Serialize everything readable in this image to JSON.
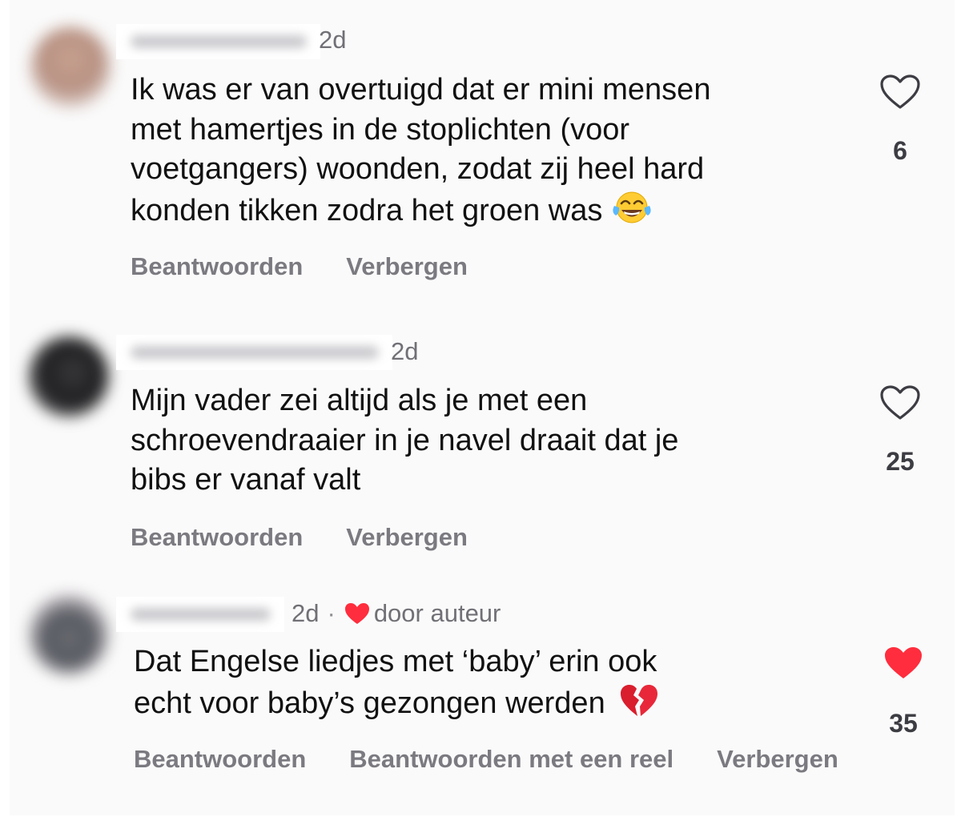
{
  "colors": {
    "like_active": "#ff2d3d",
    "muted_text": "#7a7a80",
    "panel_bg": "#fafafa"
  },
  "comments": [
    {
      "time": "2d",
      "lines": [
        "Ik was er van overtuigd dat er mini mensen",
        "met hamertjes in de stoplichten (voor",
        "voetgangers) woonden, zodat zij heel hard",
        "konden tikken zodra het groen was"
      ],
      "emoji": "tears-of-joy-emoji",
      "likes": "6",
      "liked": false,
      "actions": [
        "Beantwoorden",
        "Verbergen"
      ]
    },
    {
      "time": "2d",
      "lines": [
        "Mijn vader zei altijd als je met een",
        "schroevendraaier in je navel draait dat je",
        "bibs er vanaf valt"
      ],
      "likes": "25",
      "liked": false,
      "actions": [
        "Beantwoorden",
        "Verbergen"
      ]
    },
    {
      "time": "2d",
      "separator": "·",
      "author_badge": "door auteur",
      "lines": [
        "Dat Engelse liedjes met ‘baby’ erin ook",
        "echt voor baby’s gezongen werden"
      ],
      "emoji": "broken-heart-emoji",
      "likes": "35",
      "liked": true,
      "actions": [
        "Beantwoorden",
        "Beantwoorden met een reel",
        "Verbergen"
      ]
    }
  ]
}
